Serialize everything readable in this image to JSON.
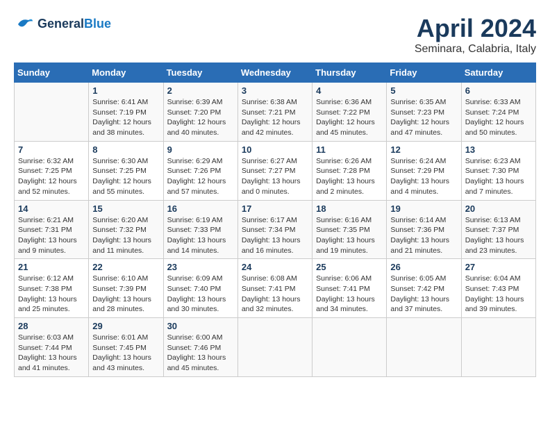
{
  "header": {
    "logo": {
      "line1": "General",
      "line2": "Blue"
    },
    "title": "April 2024",
    "location": "Seminara, Calabria, Italy"
  },
  "calendar": {
    "days_of_week": [
      "Sunday",
      "Monday",
      "Tuesday",
      "Wednesday",
      "Thursday",
      "Friday",
      "Saturday"
    ],
    "weeks": [
      [
        {
          "day": null
        },
        {
          "day": "1",
          "sunrise": "6:41 AM",
          "sunset": "7:19 PM",
          "daylight": "12 hours and 38 minutes."
        },
        {
          "day": "2",
          "sunrise": "6:39 AM",
          "sunset": "7:20 PM",
          "daylight": "12 hours and 40 minutes."
        },
        {
          "day": "3",
          "sunrise": "6:38 AM",
          "sunset": "7:21 PM",
          "daylight": "12 hours and 42 minutes."
        },
        {
          "day": "4",
          "sunrise": "6:36 AM",
          "sunset": "7:22 PM",
          "daylight": "12 hours and 45 minutes."
        },
        {
          "day": "5",
          "sunrise": "6:35 AM",
          "sunset": "7:23 PM",
          "daylight": "12 hours and 47 minutes."
        },
        {
          "day": "6",
          "sunrise": "6:33 AM",
          "sunset": "7:24 PM",
          "daylight": "12 hours and 50 minutes."
        }
      ],
      [
        {
          "day": "7",
          "sunrise": "6:32 AM",
          "sunset": "7:25 PM",
          "daylight": "12 hours and 52 minutes."
        },
        {
          "day": "8",
          "sunrise": "6:30 AM",
          "sunset": "7:25 PM",
          "daylight": "12 hours and 55 minutes."
        },
        {
          "day": "9",
          "sunrise": "6:29 AM",
          "sunset": "7:26 PM",
          "daylight": "12 hours and 57 minutes."
        },
        {
          "day": "10",
          "sunrise": "6:27 AM",
          "sunset": "7:27 PM",
          "daylight": "13 hours and 0 minutes."
        },
        {
          "day": "11",
          "sunrise": "6:26 AM",
          "sunset": "7:28 PM",
          "daylight": "13 hours and 2 minutes."
        },
        {
          "day": "12",
          "sunrise": "6:24 AM",
          "sunset": "7:29 PM",
          "daylight": "13 hours and 4 minutes."
        },
        {
          "day": "13",
          "sunrise": "6:23 AM",
          "sunset": "7:30 PM",
          "daylight": "13 hours and 7 minutes."
        }
      ],
      [
        {
          "day": "14",
          "sunrise": "6:21 AM",
          "sunset": "7:31 PM",
          "daylight": "13 hours and 9 minutes."
        },
        {
          "day": "15",
          "sunrise": "6:20 AM",
          "sunset": "7:32 PM",
          "daylight": "13 hours and 11 minutes."
        },
        {
          "day": "16",
          "sunrise": "6:19 AM",
          "sunset": "7:33 PM",
          "daylight": "13 hours and 14 minutes."
        },
        {
          "day": "17",
          "sunrise": "6:17 AM",
          "sunset": "7:34 PM",
          "daylight": "13 hours and 16 minutes."
        },
        {
          "day": "18",
          "sunrise": "6:16 AM",
          "sunset": "7:35 PM",
          "daylight": "13 hours and 19 minutes."
        },
        {
          "day": "19",
          "sunrise": "6:14 AM",
          "sunset": "7:36 PM",
          "daylight": "13 hours and 21 minutes."
        },
        {
          "day": "20",
          "sunrise": "6:13 AM",
          "sunset": "7:37 PM",
          "daylight": "13 hours and 23 minutes."
        }
      ],
      [
        {
          "day": "21",
          "sunrise": "6:12 AM",
          "sunset": "7:38 PM",
          "daylight": "13 hours and 25 minutes."
        },
        {
          "day": "22",
          "sunrise": "6:10 AM",
          "sunset": "7:39 PM",
          "daylight": "13 hours and 28 minutes."
        },
        {
          "day": "23",
          "sunrise": "6:09 AM",
          "sunset": "7:40 PM",
          "daylight": "13 hours and 30 minutes."
        },
        {
          "day": "24",
          "sunrise": "6:08 AM",
          "sunset": "7:41 PM",
          "daylight": "13 hours and 32 minutes."
        },
        {
          "day": "25",
          "sunrise": "6:06 AM",
          "sunset": "7:41 PM",
          "daylight": "13 hours and 34 minutes."
        },
        {
          "day": "26",
          "sunrise": "6:05 AM",
          "sunset": "7:42 PM",
          "daylight": "13 hours and 37 minutes."
        },
        {
          "day": "27",
          "sunrise": "6:04 AM",
          "sunset": "7:43 PM",
          "daylight": "13 hours and 39 minutes."
        }
      ],
      [
        {
          "day": "28",
          "sunrise": "6:03 AM",
          "sunset": "7:44 PM",
          "daylight": "13 hours and 41 minutes."
        },
        {
          "day": "29",
          "sunrise": "6:01 AM",
          "sunset": "7:45 PM",
          "daylight": "13 hours and 43 minutes."
        },
        {
          "day": "30",
          "sunrise": "6:00 AM",
          "sunset": "7:46 PM",
          "daylight": "13 hours and 45 minutes."
        },
        {
          "day": null
        },
        {
          "day": null
        },
        {
          "day": null
        },
        {
          "day": null
        }
      ]
    ]
  }
}
